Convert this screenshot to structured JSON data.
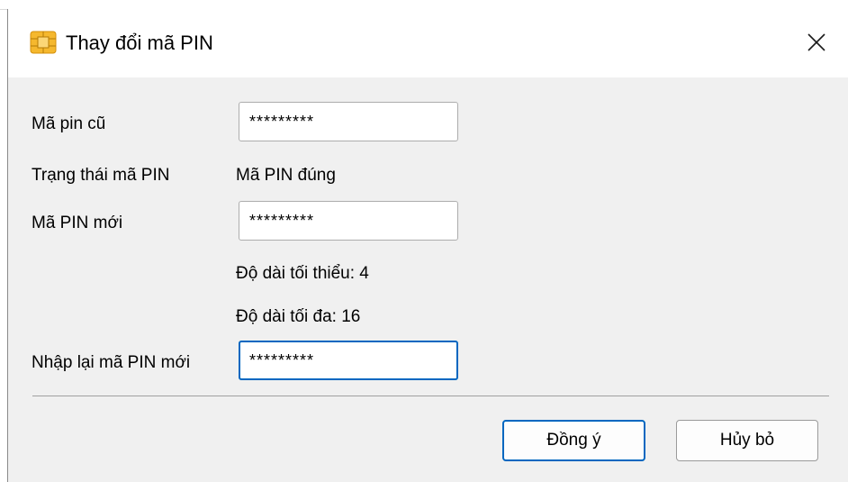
{
  "window": {
    "title": "Thay đổi mã PIN",
    "icon": "smart-card-chip-icon",
    "close_icon": "close-icon"
  },
  "form": {
    "old_pin_label": "Mã pin cũ",
    "old_pin_value": "*********",
    "status_label": "Trạng thái mã PIN",
    "status_value": "Mã PIN đúng",
    "new_pin_label": "Mã PIN mới",
    "new_pin_value": "*********",
    "min_length_text": "Độ dài tối thiểu: 4",
    "max_length_text": "Độ dài tối đa: 16",
    "confirm_pin_label": "Nhập lại mã PIN mới",
    "confirm_pin_value": "*********"
  },
  "buttons": {
    "ok_label": "Đồng ý",
    "cancel_label": "Hủy bỏ"
  },
  "colors": {
    "focus_accent": "#0067c0",
    "icon_gold": "#f5b82e"
  }
}
